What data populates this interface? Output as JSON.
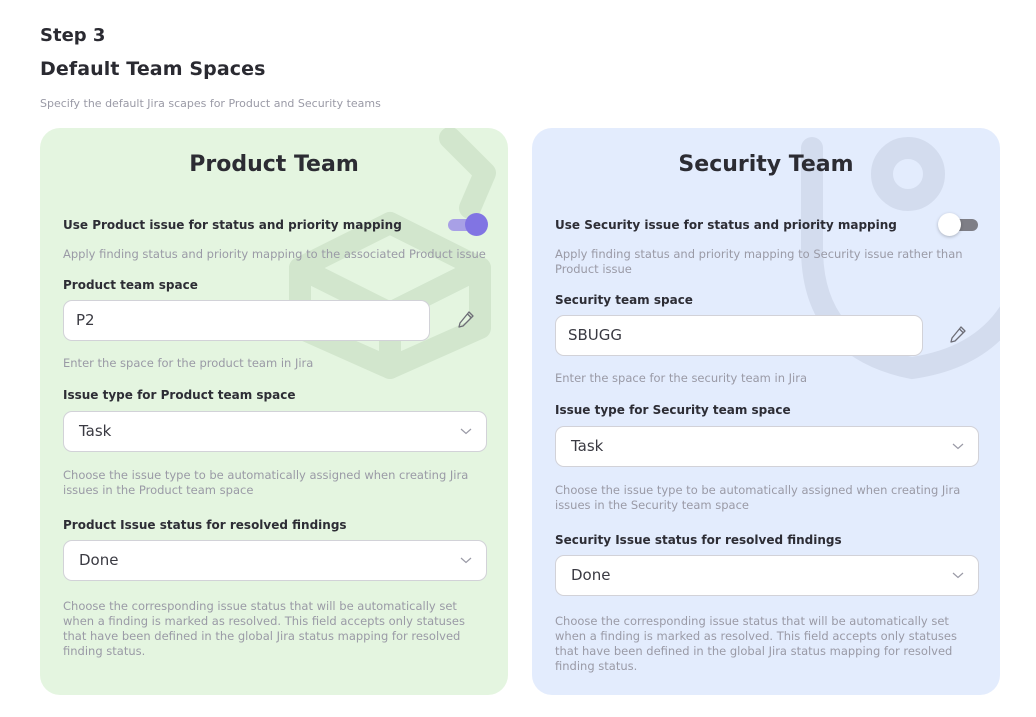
{
  "header": {
    "step": "Step 3",
    "title": "Default Team Spaces",
    "subtitle": "Specify the default Jira scapes for Product and Security teams"
  },
  "product": {
    "title": "Product Team",
    "toggle_label": "Use Product issue for status and priority mapping",
    "toggle_on": true,
    "toggle_hint": "Apply finding status and priority mapping to the associated Product issue",
    "space_label": "Product team space",
    "space_value": "P2",
    "space_hint": "Enter the space for the product team in Jira",
    "issue_type_label": "Issue type for Product team space",
    "issue_type_value": "Task",
    "issue_type_hint": "Choose the issue type to be automatically assigned when creating Jira issues in the Product team space",
    "status_label": "Product Issue status for resolved findings",
    "status_value": "Done",
    "status_hint": "Choose the corresponding issue status that will be automatically set when a finding is marked as resolved. This field accepts only statuses that have been defined in the global Jira status mapping for resolved finding status."
  },
  "security": {
    "title": "Security Team",
    "toggle_label": "Use Security issue for status and priority mapping",
    "toggle_on": false,
    "toggle_hint": "Apply finding status and priority mapping to Security issue rather than Product issue",
    "space_label": "Security team space",
    "space_value": "SBUGG",
    "space_hint": "Enter the space for the security team in Jira",
    "issue_type_label": "Issue type for Security team space",
    "issue_type_value": "Task",
    "issue_type_hint": "Choose the issue type to be automatically assigned when creating Jira issues in the Security team space",
    "status_label": "Security Issue status for resolved findings",
    "status_value": "Done",
    "status_hint": "Choose the corresponding issue status that will be automatically set when a finding is marked as resolved. This field accepts only statuses that have been defined in the global Jira status mapping for resolved finding status."
  },
  "icons": {
    "pencil": "pencil-icon",
    "chevron": "chevron-down-icon",
    "product_watermark": "cube-icon",
    "security_watermark": "user-icon"
  },
  "colors": {
    "product_bg": "#e4f5e0",
    "security_bg": "#e3ecfd",
    "toggle_on": "#8174e3",
    "toggle_off": "#7e7e86"
  }
}
